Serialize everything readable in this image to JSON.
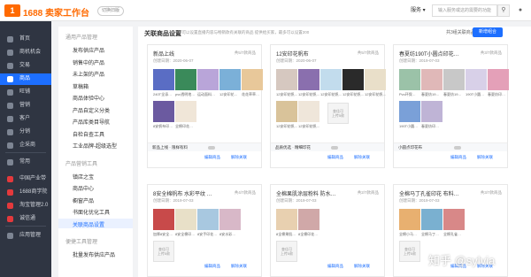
{
  "header": {
    "logo_mark": "1",
    "app_title": "1688 卖家工作台",
    "switch_old": "切换旧版",
    "search_scope": "服务",
    "search_placeholder": "输入服务或这的需要的功能",
    "search_icon": "search-icon",
    "user_icon": "user-icon"
  },
  "sidebar": {
    "items": [
      {
        "label": "首页",
        "icon": "home-icon"
      },
      {
        "label": "商机机会",
        "icon": "opportunity-icon"
      },
      {
        "label": "交易",
        "icon": "trade-icon"
      },
      {
        "label": "商品",
        "icon": "goods-icon",
        "active": true
      },
      {
        "label": "旺铺",
        "icon": "shop-icon"
      },
      {
        "label": "营销",
        "icon": "marketing-icon"
      },
      {
        "label": "客户",
        "icon": "customer-icon"
      },
      {
        "label": "分销",
        "icon": "distribution-icon"
      },
      {
        "label": "企采商",
        "icon": "procure-icon"
      },
      {
        "label": "常用",
        "icon": "star-icon"
      },
      {
        "label": "中国产业带",
        "icon": "industry-icon"
      },
      {
        "label": "1688商学院",
        "icon": "academy-icon"
      },
      {
        "label": "淘宝管理2.0",
        "icon": "taobao-icon"
      },
      {
        "label": "诚信通",
        "icon": "trust-icon"
      },
      {
        "label": "应用管理",
        "icon": "app-icon"
      }
    ]
  },
  "subnav": {
    "groups": [
      {
        "title": "通用产品管理",
        "items": [
          "发布供应产品",
          "销售中的产品",
          "未上架的产品",
          "草稿箱",
          "商品体验中心",
          "产品自定义分类",
          "产品库类目导航",
          "自检自查工具",
          "工业品牌-超级选型"
        ]
      },
      {
        "title": "产品营销工具",
        "items": [
          "镇店之宝",
          "商品中心",
          "橱窗产品",
          "书面化优化工具",
          "关联商品设置"
        ]
      },
      {
        "title": "便捷工具管理",
        "items": [
          "批量发布供应产品"
        ]
      }
    ],
    "selected": "关联商品设置"
  },
  "main": {
    "title": "关联商品设置",
    "description": "您可以设置直播内容与畅销款有关联的商品 提供给买家，最多可以设置200",
    "linked_count": "共3组关联商品",
    "add_button": "新增组合"
  },
  "cards": [
    {
      "title": "新品上线",
      "count": "共5/7款商品",
      "date": "创建日期：2020-06-07",
      "thumbs": [
        {
          "caption": "240T全涤…",
          "color": "#5a6dc4"
        },
        {
          "caption": "pvc透明地…",
          "color": "#3a8a5a"
        },
        {
          "caption": "运动面料…",
          "color": "#b9a5d9"
        },
        {
          "caption": "12安印花…",
          "color": "#7bb0d8"
        },
        {
          "caption": "花花草草…",
          "color": "#e8c89a"
        }
      ],
      "thumbs2": [
        {
          "caption": "8安帆布印…",
          "color": "#6b5aa0"
        },
        {
          "caption": "全棉印花…",
          "color": "#f0e6d8"
        }
      ],
      "tag": "新品上线 · 限样有料",
      "edit": "编辑商品",
      "unlink": "解除关联"
    },
    {
      "title": "12安印花帆布",
      "count": "共5/7款商品",
      "date": "创建日期：2020-06-07",
      "thumbs": [
        {
          "caption": "12安印花帆…",
          "color": "#d6c8c0"
        },
        {
          "caption": "12安印花帆…",
          "color": "#8a6fae"
        },
        {
          "caption": "12安印花帆…",
          "color": "#c2dced"
        },
        {
          "caption": "12安印花帆…",
          "color": "#2a2a2a"
        },
        {
          "caption": "12安印花帆…",
          "color": "#e9dfc9"
        }
      ],
      "thumbs2": [
        {
          "caption": "12安印花帆…",
          "color": "#d9c39a"
        },
        {
          "caption": "12安印花帆…",
          "color": "#efe6da"
        }
      ],
      "empty": [
        "查佳可",
        "上传5款"
      ],
      "tag": "品质优选 · 精细印花",
      "edit": "编辑商品",
      "unlink": "解除关联"
    },
    {
      "title": "春夏纺190T小圆点印花…",
      "count": "共3/7款商品",
      "date": "创建日期：2019-07-03",
      "thumbs": [
        {
          "caption": "Pvc环保…",
          "color": "#9bc2a8"
        },
        {
          "caption": "春夏纺19…",
          "color": "#e0b8b8"
        },
        {
          "caption": "春夏纺19…",
          "color": "#c8c8c8"
        },
        {
          "caption": "190T小圆…",
          "color": "#d8d0e8"
        },
        {
          "caption": "春夏纺印…",
          "color": "#e4a0b8"
        }
      ],
      "thumbs2": [
        {
          "caption": "190T小圆…",
          "color": "#7aa0d8"
        },
        {
          "caption": "春夏纺印…",
          "color": "#bfb4d6"
        }
      ],
      "tag": "小圆点印花布",
      "edit": "编辑商品",
      "unlink": "解除关联"
    },
    {
      "title": "8安全棉帆布 水彩平纹 …",
      "count": "共4/7款商品",
      "date": "创建日期：2019-07-03",
      "thumbs": [
        {
          "caption": "加厚8安全…",
          "color": "#c84a4a"
        },
        {
          "caption": "8安全棉印…",
          "color": "#e8e0c8"
        },
        {
          "caption": "8安手印花…",
          "color": "#a8c8e0"
        },
        {
          "caption": "8安水彩…",
          "color": "#d8b8c8"
        }
      ],
      "empty": [
        "查佳可",
        "上传5款"
      ],
      "edit": "编辑商品",
      "unlink": "解除关联"
    },
    {
      "title": "全棉果肌涂层粉料 防水…",
      "count": "共2/7款商品",
      "date": "创建日期：2019-07-03",
      "thumbs": [
        {
          "caption": "8全棉果肌…",
          "color": "#e8d0b0"
        },
        {
          "caption": "8全棉印花…",
          "color": "#d0a8a8"
        }
      ],
      "empty": [
        "查佳可",
        "上传5款"
      ],
      "edit": "编辑商品",
      "unlink": "解除关联"
    },
    {
      "title": "全棉马丁孔雀印花 布料…",
      "count": "共3/7款商品",
      "date": "创建日期：2019-07-03",
      "thumbs": [
        {
          "caption": "全棉小马…",
          "color": "#e8b070"
        },
        {
          "caption": "全棉马丁…",
          "color": "#7ab0d0"
        },
        {
          "caption": "全棉孔雀…",
          "color": "#d88888"
        }
      ],
      "empty": [
        "查佳可",
        "上传5款"
      ],
      "edit": "编辑商品",
      "unlink": "解除关联"
    }
  ],
  "watermark": "知乎 @sylvia",
  "colors": {
    "accent": "#1d6fff",
    "brand": "#ff6a00",
    "sidebar_bg": "#2f3542"
  }
}
